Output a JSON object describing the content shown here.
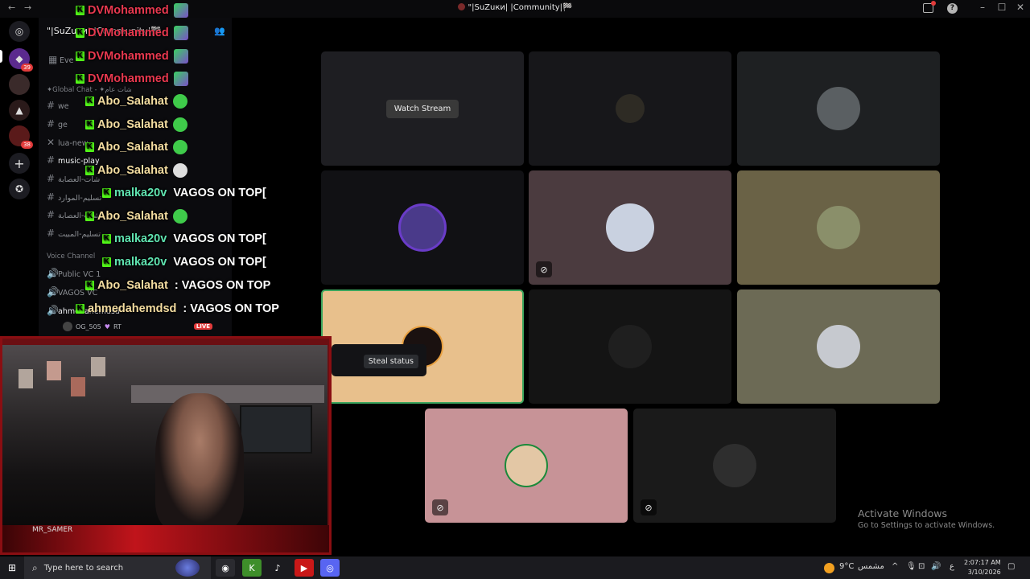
{
  "window": {
    "title": "\"|SuZuки| |Community|🏁",
    "back_glyph": "←",
    "forward_glyph": "→",
    "minimize": "–",
    "maximize": "☐",
    "close": "✕"
  },
  "server": {
    "name": "\"|SuZuки| |Community|🏁",
    "events_label": "Eve"
  },
  "rail": {
    "badge_1": "39",
    "badge_2": "38"
  },
  "channels": [
    {
      "label": "✦Global Chat - ✦شات عام",
      "type": "category"
    },
    {
      "label": "we",
      "type": "text"
    },
    {
      "label": "ge",
      "type": "text"
    },
    {
      "label": "lua-new",
      "type": "text"
    },
    {
      "label": "music-play",
      "type": "text"
    },
    {
      "label": "شات-العصابة",
      "type": "text"
    },
    {
      "label": "تسليم-الموارد",
      "type": "text"
    },
    {
      "label": "شات-العصابة",
      "type": "text"
    },
    {
      "label": "تسليم-المبيت",
      "type": "text"
    },
    {
      "label": "Voice Channel",
      "type": "category"
    },
    {
      "label": "Public VC 1",
      "type": "voice"
    },
    {
      "label": "VAGOS VC",
      "type": "voice"
    },
    {
      "label": "ahmedahemdsd",
      "type": "voice"
    }
  ],
  "voice_user": {
    "name": "OG_505",
    "tag": "RT",
    "live_label": "LIVE"
  },
  "chat_overlay": [
    {
      "user": "DVMohammed",
      "text": "",
      "color": "#e8384f",
      "badge": "green"
    },
    {
      "user": "DVMohammed",
      "text": "",
      "color": "#e8384f",
      "badge": "green"
    },
    {
      "user": "DVMohammed",
      "text": "",
      "color": "#e8384f",
      "badge": "green"
    },
    {
      "user": "DVMohammed",
      "text": "",
      "color": "#e8384f",
      "badge": "purple"
    },
    {
      "user": "Abo_Salahat",
      "text": "",
      "color": "#f3dca0",
      "badge": "lime"
    },
    {
      "user": "Abo_Salahat",
      "text": "",
      "color": "#f3dca0",
      "badge": "lime"
    },
    {
      "user": "Abo_Salahat",
      "text": "",
      "color": "#f3dca0",
      "badge": "lime"
    },
    {
      "user": "Abo_Salahat",
      "text": "",
      "color": "#f3dca0",
      "badge": "white"
    },
    {
      "user": "malka20v",
      "text": "VAGOS ON TOP[",
      "color": "#5fe3b0",
      "badge": ""
    },
    {
      "user": "Abo_Salahat",
      "text": "",
      "color": "#f3dca0",
      "badge": "lime"
    },
    {
      "user": "malka20v",
      "text": "VAGOS ON TOP[",
      "color": "#5fe3b0",
      "badge": ""
    },
    {
      "user": "malka20v",
      "text": "VAGOS ON TOP[",
      "color": "#5fe3b0",
      "badge": ""
    },
    {
      "user": "Abo_Salahat",
      "text": ": VAGOS ON TOP",
      "color": "#f3dca0",
      "badge": ""
    },
    {
      "user": "ahmedahemdsd",
      "text": ": VAGOS ON TOP",
      "color": "#f3dca0",
      "badge": ""
    }
  ],
  "cam": {
    "name": "MR_SAMER"
  },
  "stage": {
    "watch_stream_label": "Watch Stream",
    "steal_status_label": "Steal status",
    "tiles": [
      {
        "bg": "#1e1e22",
        "avatar": "#3a3a40",
        "muted": false
      },
      {
        "bg": "#17171a",
        "avatar": "#2e2b24",
        "muted": false
      },
      {
        "bg": "#1e2022",
        "avatar": "#5a5f62",
        "muted": false
      },
      {
        "bg": "#111114",
        "avatar": "#4a3a8a",
        "muted": false
      },
      {
        "bg": "#4b3b3f",
        "avatar": "#c9d1e0",
        "muted": true
      },
      {
        "bg": "#6a6246",
        "avatar": "#8a8f6a",
        "muted": false
      },
      {
        "bg": "#e8c08c",
        "avatar": "#1a1110",
        "muted": false
      },
      {
        "bg": "#141414",
        "avatar": "#1f1f1f",
        "muted": false
      },
      {
        "bg": "#6c6a55",
        "avatar": "#c6c9cf",
        "muted": false
      },
      {
        "bg": "#c79397",
        "avatar": "#e3c7a5",
        "muted": true
      },
      {
        "bg": "#1a1a1a",
        "avatar": "#2e2e2e",
        "muted": true
      }
    ]
  },
  "activation": {
    "title": "Activate Windows",
    "subtitle": "Go to Settings to activate Windows."
  },
  "taskbar": {
    "search_placeholder": "Type here to search",
    "temperature": "9°C",
    "weather": "مشمس",
    "lang": "ع",
    "time": "2:07:17 AM",
    "date": "3/10/2026"
  },
  "colors": {
    "kick_green": "#53fc18",
    "live_red": "#e23b3b",
    "stream_frame": "#8a0e12"
  }
}
